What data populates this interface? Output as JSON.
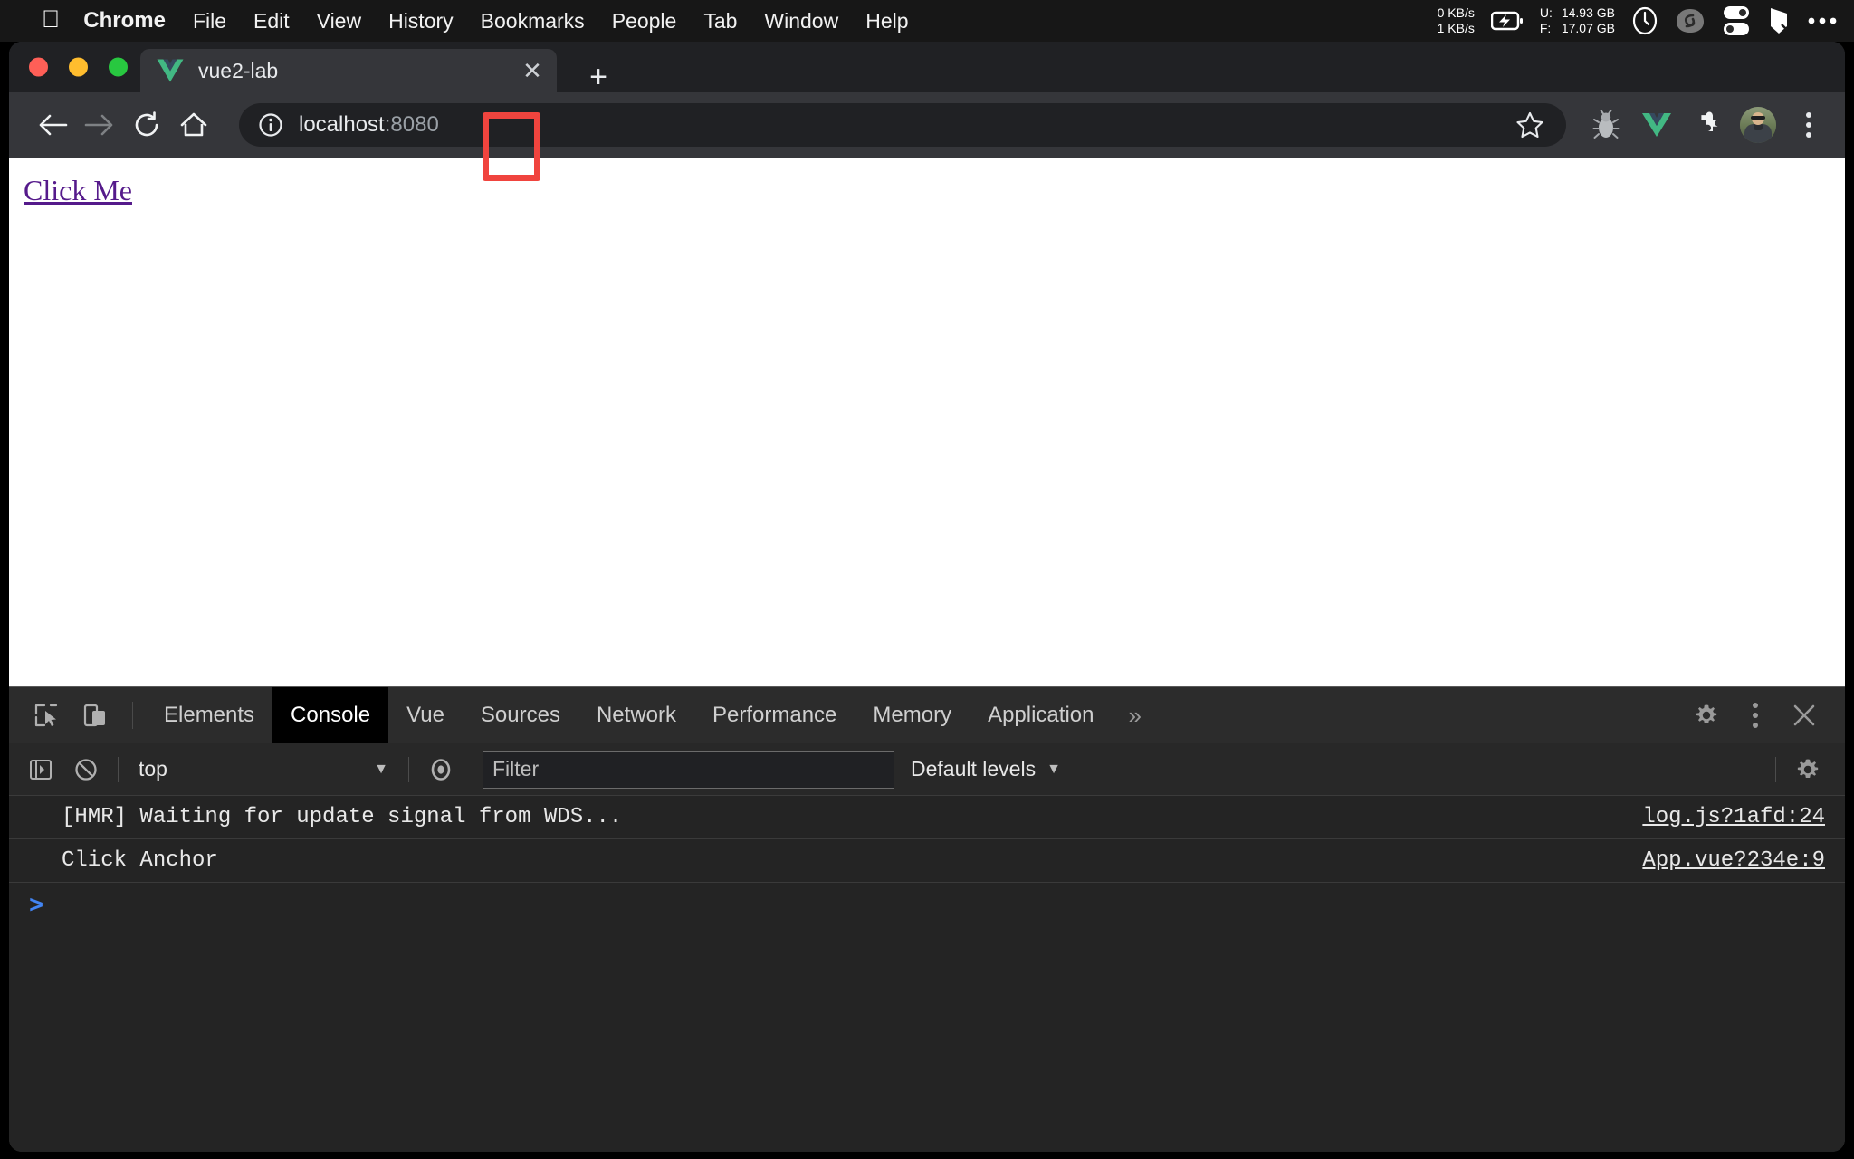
{
  "menubar": {
    "apple_icon": "apple-logo",
    "items": [
      {
        "label": "Chrome",
        "bold": true
      },
      {
        "label": "File",
        "bold": false
      },
      {
        "label": "Edit",
        "bold": false
      },
      {
        "label": "View",
        "bold": false
      },
      {
        "label": "History",
        "bold": false
      },
      {
        "label": "Bookmarks",
        "bold": false
      },
      {
        "label": "People",
        "bold": false
      },
      {
        "label": "Tab",
        "bold": false
      },
      {
        "label": "Window",
        "bold": false
      },
      {
        "label": "Help",
        "bold": false
      }
    ],
    "status": {
      "net_up": "0 KB/s",
      "net_down": "1 KB/s",
      "battery_icon": "battery-charging-icon",
      "mem_used_label": "U:",
      "mem_used_value": "14.93 GB",
      "mem_free_label": "F:",
      "mem_free_value": "17.07 GB",
      "clock_icon": "clock-icon",
      "vpn_icon": "loop-icon",
      "toggle_icon": "toggles-icon",
      "flag_icon": "flag-icon",
      "overflow_icon": "ellipsis-icon"
    }
  },
  "browser": {
    "tab": {
      "favicon": "vue-logo-icon",
      "title": "vue2-lab",
      "close_icon": "close-icon"
    },
    "new_tab_label": "+",
    "nav": {
      "back_icon": "arrow-left-icon",
      "forward_icon": "arrow-right-icon",
      "reload_icon": "reload-icon",
      "home_icon": "home-icon"
    },
    "omnibox": {
      "security_icon": "info-circle-icon",
      "host": "localhost",
      "port": ":8080",
      "full_url": "localhost:8080",
      "bookmark_icon": "star-outline-icon"
    },
    "toolbar_icons": [
      {
        "name": "bug-icon"
      },
      {
        "name": "vue-devtools-icon"
      },
      {
        "name": "extensions-puzzle-icon"
      },
      {
        "name": "profile-avatar"
      },
      {
        "name": "chrome-menu-icon"
      }
    ]
  },
  "page": {
    "link_text": "Click Me",
    "link_color": "#551a8b",
    "background": "#ffffff"
  },
  "devtools": {
    "left_tools": [
      {
        "name": "inspect-element-icon"
      },
      {
        "name": "device-toolbar-icon"
      }
    ],
    "tabs": [
      {
        "label": "Elements",
        "active": false
      },
      {
        "label": "Console",
        "active": true
      },
      {
        "label": "Vue",
        "active": false
      },
      {
        "label": "Sources",
        "active": false
      },
      {
        "label": "Network",
        "active": false
      },
      {
        "label": "Performance",
        "active": false
      },
      {
        "label": "Memory",
        "active": false
      },
      {
        "label": "Application",
        "active": false
      }
    ],
    "more_tabs_label": "»",
    "right_buttons": [
      {
        "name": "settings-gear-icon"
      },
      {
        "name": "devtools-menu-icon"
      },
      {
        "name": "close-devtools-icon"
      }
    ],
    "filterbar": {
      "sidebar_toggle_icon": "console-sidebar-icon",
      "clear_console_icon": "clear-console-icon",
      "context_value": "top",
      "context_caret": "▼",
      "live_expression_icon": "eye-icon",
      "filter_placeholder": "Filter",
      "filter_value": "",
      "levels_label": "Default levels",
      "levels_caret": "▼",
      "settings_icon": "console-settings-gear-icon"
    },
    "console_rows": [
      {
        "text": "[HMR] Waiting for update signal from WDS...",
        "source": "log.js?1afd:24"
      },
      {
        "text": "Click Anchor",
        "source": "App.vue?234e:9"
      }
    ],
    "prompt_caret": ">"
  },
  "annotation": {
    "type": "highlight-rectangle",
    "color": "#f0443e",
    "target": "omnibox-url-end"
  }
}
